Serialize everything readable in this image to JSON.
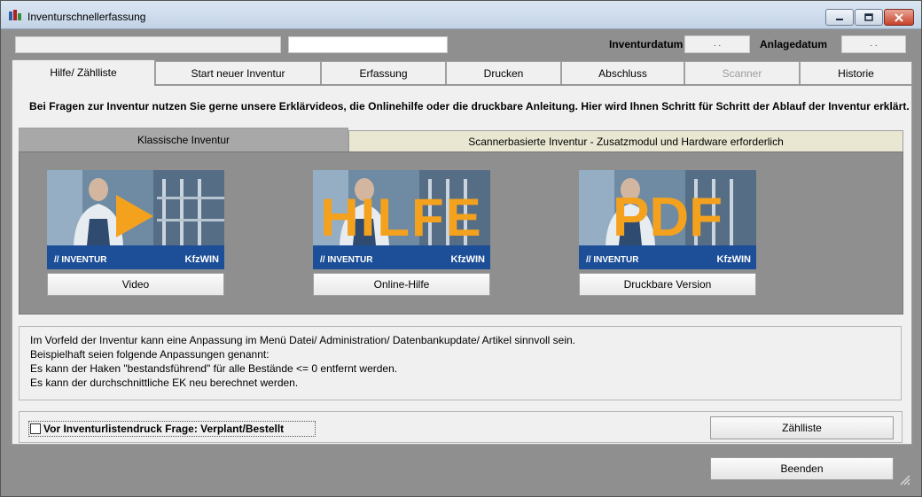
{
  "window": {
    "title": "Inventurschnellerfassung"
  },
  "header": {
    "inventurdatum_label": "Inventurdatum",
    "inventurdatum_value": ". .",
    "anlagedatum_label": "Anlagedatum",
    "anlagedatum_value": ". ."
  },
  "tabs": [
    {
      "label": "Hilfe/ Zählliste",
      "state": "active"
    },
    {
      "label": "Start neuer Inventur",
      "state": "normal"
    },
    {
      "label": "Erfassung",
      "state": "normal"
    },
    {
      "label": "Drucken",
      "state": "normal"
    },
    {
      "label": "Abschluss",
      "state": "normal"
    },
    {
      "label": "Scanner",
      "state": "disabled"
    },
    {
      "label": "Historie",
      "state": "normal"
    }
  ],
  "help": {
    "intro": "Bei Fragen zur Inventur nutzen Sie gerne unsere Erklärvideos, die Onlinehilfe oder die druckbare Anleitung. Hier wird Ihnen Schritt für Schritt der Ablauf der Inventur erklärt.",
    "inner_tabs": [
      {
        "label": "Klassische Inventur",
        "state": "active"
      },
      {
        "label": "Scannerbasierte Inventur - Zusatzmodul und Hardware erforderlich",
        "state": "inactive"
      }
    ],
    "cards": [
      {
        "overlay": "",
        "brand_left": "// INVENTUR",
        "brand_right": "KfzWIN",
        "button": "Video",
        "icon": "play-icon"
      },
      {
        "overlay": "HILFE",
        "brand_left": "// INVENTUR",
        "brand_right": "KfzWIN",
        "button": "Online-Hilfe"
      },
      {
        "overlay": "PDF",
        "brand_left": "// INVENTUR",
        "brand_right": "KfzWIN",
        "button": "Druckbare Version"
      }
    ]
  },
  "notes": [
    "Im Vorfeld der Inventur kann eine Anpassung im Menü Datei/ Administration/ Datenbankupdate/ Artikel sinnvoll sein.",
    "Beispielhaft seien folgende Anpassungen genannt:",
    "Es kann der Haken \"bestandsführend\" für alle Bestände <= 0 entfernt werden.",
    "Es kann der durchschnittliche EK neu berechnet werden."
  ],
  "options": {
    "checkbox_label": "Vor Inventurlistendruck Frage: Verplant/Bestellt",
    "checkbox_checked": false,
    "zaehlliste_button": "Zählliste"
  },
  "footer": {
    "beenden_button": "Beenden"
  },
  "colors": {
    "overlay_orange": "#f4a21e",
    "brand_blue": "#1d4f98"
  }
}
